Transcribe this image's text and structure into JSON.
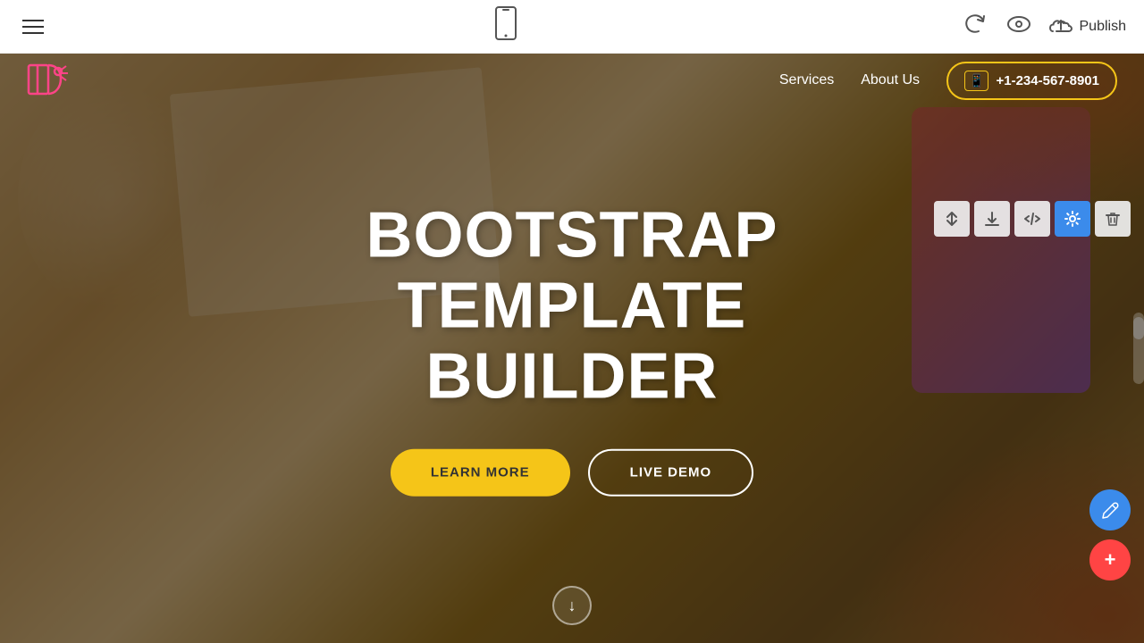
{
  "toolbar": {
    "publish_label": "Publish",
    "hamburger_label": "Menu"
  },
  "nav": {
    "services_label": "Services",
    "about_label": "About Us",
    "phone_number": "+1-234-567-8901"
  },
  "hero": {
    "title_line1": "BOOTSTRAP",
    "title_line2": "TEMPLATE BUILDER",
    "btn_learn_more": "LEARN MORE",
    "btn_live_demo": "LIVE DEMO"
  },
  "section_tools": {
    "move": "⇅",
    "download": "⬇",
    "code": "</>",
    "settings": "⚙",
    "delete": "🗑"
  },
  "fab": {
    "edit_icon": "✏",
    "add_icon": "+"
  }
}
